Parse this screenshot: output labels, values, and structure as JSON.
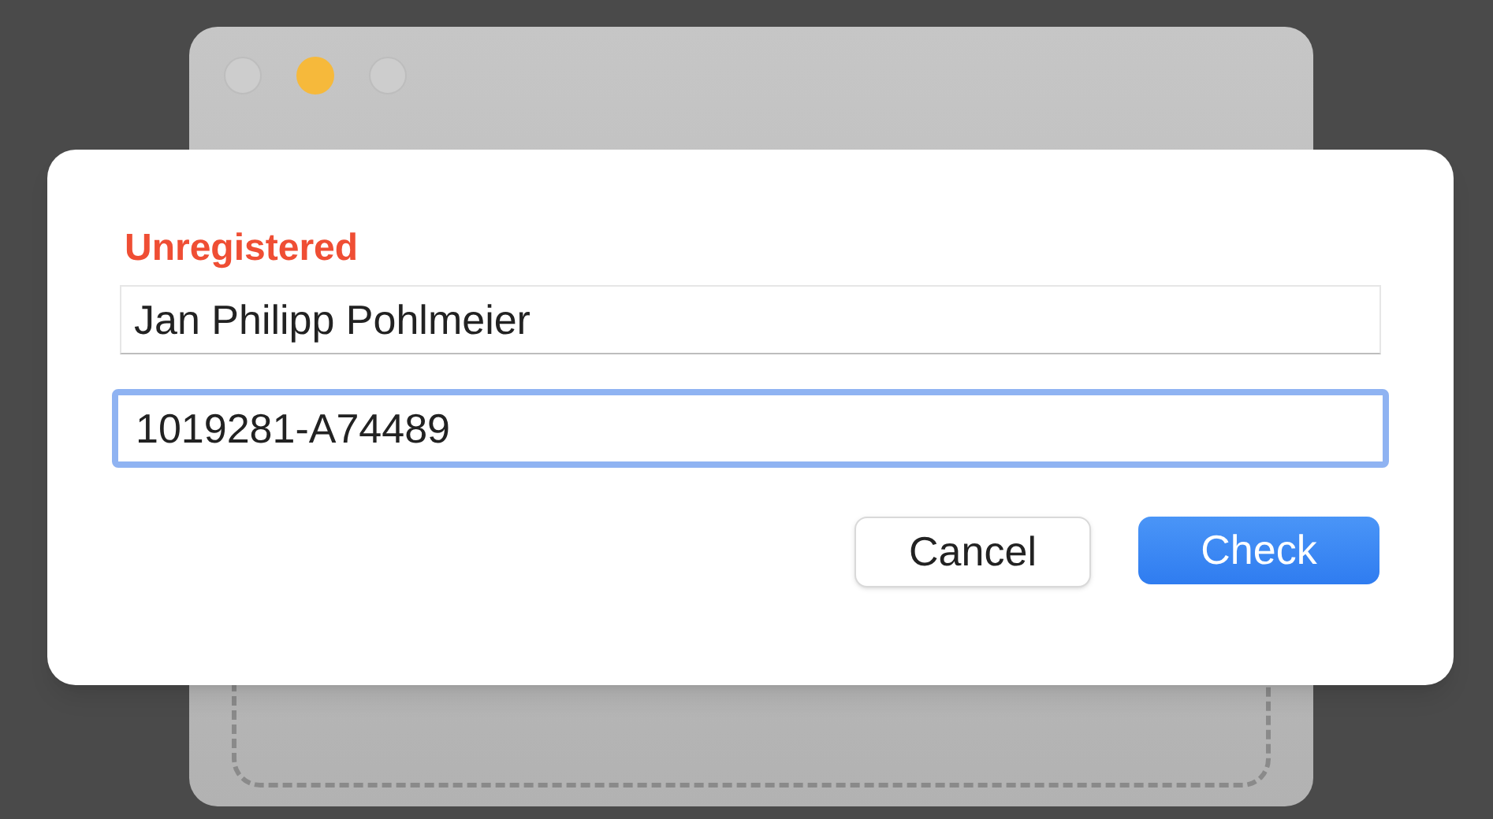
{
  "dialog": {
    "title": "Unregistered",
    "fields": [
      {
        "value": "Jan Philipp Pohlmeier",
        "focused": false
      },
      {
        "value": "1019281-A74489",
        "focused": true
      }
    ],
    "buttons": [
      {
        "label": "Cancel",
        "default": false
      },
      {
        "label": "Check",
        "default": true
      }
    ]
  }
}
